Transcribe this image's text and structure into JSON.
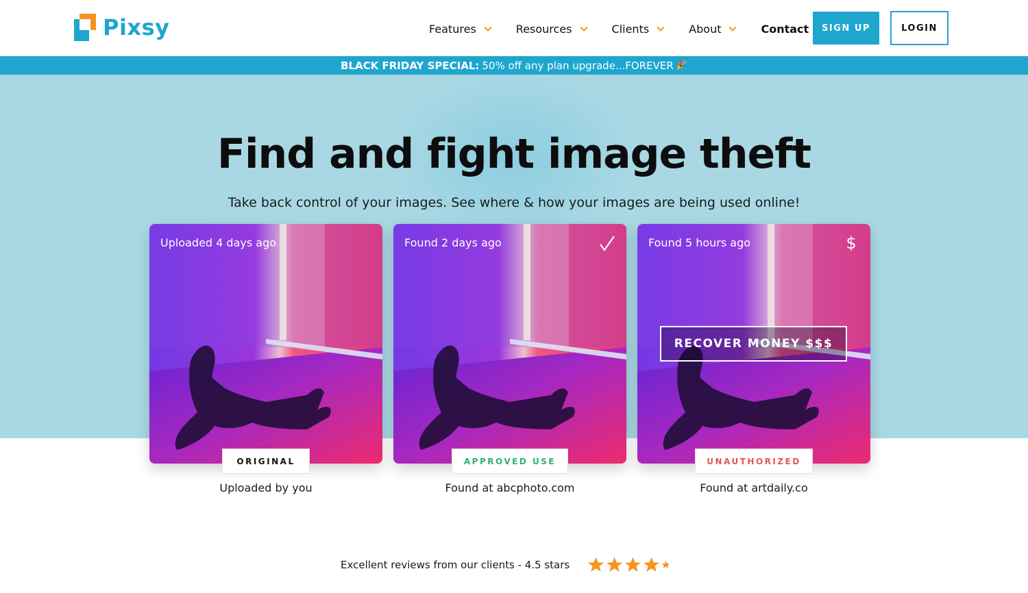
{
  "brand": {
    "name": "Pixsy"
  },
  "nav": {
    "items": [
      {
        "label": "Features"
      },
      {
        "label": "Resources"
      },
      {
        "label": "Clients"
      },
      {
        "label": "About"
      }
    ],
    "contact": "Contact",
    "signup": "SIGN UP",
    "login": "LOGIN"
  },
  "banner": {
    "bold": "BLACK FRIDAY SPECIAL:",
    "text": "50% off any plan upgrade...FOREVER",
    "emoji": "🎉"
  },
  "hero": {
    "title": "Find and fight image theft",
    "subtitle": "Take back control of your images. See where & how your images are being used online!"
  },
  "cards": [
    {
      "time": "Uploaded 4 days ago",
      "icon": "",
      "tag": "ORIGINAL",
      "tag_color": "#111111",
      "caption": "Uploaded by you"
    },
    {
      "time": "Found 2 days ago",
      "icon": "check-icon",
      "tag": "APPROVED USE",
      "tag_color": "#2fb36a",
      "caption": "Found at abcphoto.com"
    },
    {
      "time": "Found 5 hours ago",
      "icon": "dollar-icon",
      "tag": "UNAUTHORIZED",
      "tag_color": "#e3545a",
      "caption": "Found at artdaily.co",
      "action": "RECOVER MONEY $$$"
    }
  ],
  "reviews": {
    "text": "Excellent reviews from our clients - 4.5 stars",
    "rating": 4.5,
    "max": 5
  },
  "colors": {
    "brand_blue": "#1ea6cf",
    "brand_orange": "#f7941d",
    "hero_bg": "#a9d8e4",
    "star": "#f7941d"
  }
}
